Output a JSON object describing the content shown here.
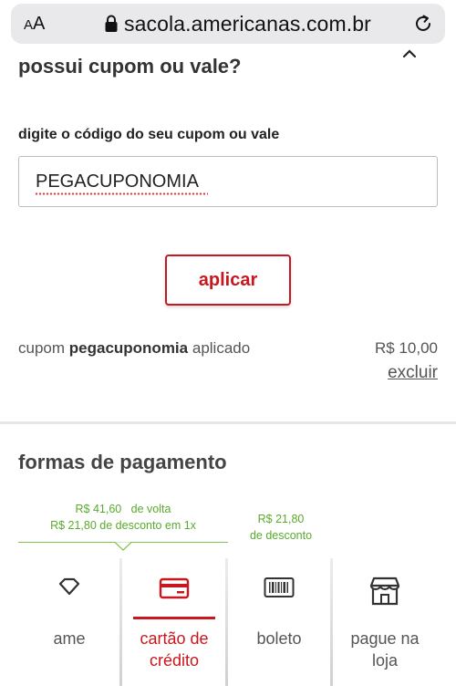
{
  "browser": {
    "aa_large": "A",
    "aa_small": "A",
    "url": "sacola.americanas.com.br"
  },
  "coupon": {
    "title": "possui cupom ou vale?",
    "label": "digite o código do seu cupom ou vale",
    "input_value": "PEGACUPONOMIA",
    "apply_label": "aplicar",
    "applied_prefix": "cupom",
    "applied_code": "pegacuponomia",
    "applied_suffix": "aplicado",
    "applied_value": "R$ 10,00",
    "remove_label": "excluir"
  },
  "payment": {
    "title": "formas de pagamento",
    "promo_ame_line1": "R$ 41,60   de volta",
    "promo_ame_line2": "R$ 21,80 de desconto em 1x",
    "promo_boleto_line1": "R$ 21,80",
    "promo_boleto_line2": "de desconto",
    "tabs": [
      {
        "label": "ame",
        "icon": "ame-heart-icon"
      },
      {
        "label": "cartão de crédito",
        "icon": "credit-card-icon",
        "active": true
      },
      {
        "label": "boleto",
        "icon": "barcode-icon"
      },
      {
        "label": "pague na loja",
        "icon": "store-icon"
      }
    ],
    "colors": {
      "accent": "#c8171e",
      "promo": "#5aaa2c"
    }
  }
}
